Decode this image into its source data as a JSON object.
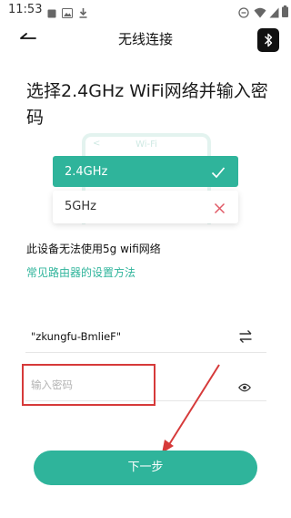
{
  "status_bar": {
    "time": "11:53"
  },
  "header": {
    "title": "无线连接"
  },
  "heading": "选择2.4GHz WiFi网络并输入密码",
  "illustration": {
    "phone_label": "Wi-Fi",
    "phone_back": "<",
    "options": [
      {
        "label": "2.4GHz",
        "state": "supported",
        "icon": "check-icon"
      },
      {
        "label": "5GHz",
        "state": "unsupported",
        "icon": "cross-icon"
      }
    ]
  },
  "note": "此设备无法使用5g wifi网络",
  "router_link": "常见路由器的设置方法",
  "ssid_field": {
    "value": "\"zkungfu-BmlieF\""
  },
  "password_field": {
    "placeholder": "输入密码",
    "value": ""
  },
  "next_button": {
    "label": "下一步"
  },
  "colors": {
    "accent": "#2fb49b",
    "annotation": "#d63a3a",
    "unsupported": "#e05a66"
  }
}
